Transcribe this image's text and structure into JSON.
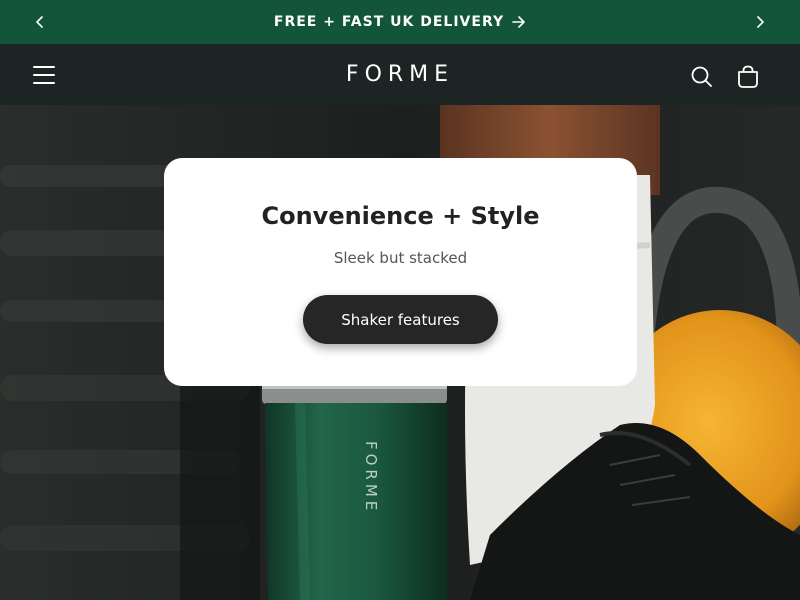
{
  "announcement": {
    "text": "FREE + FAST UK DELIVERY",
    "prev_icon": "chevron-left-icon",
    "next_icon": "chevron-right-icon"
  },
  "header": {
    "logo": "FORME",
    "menu_icon": "hamburger-icon",
    "search_icon": "search-icon",
    "cart_icon": "cart-icon"
  },
  "hero": {
    "bottle_brand": "FORME"
  },
  "card": {
    "title": "Convenience + Style",
    "subtitle": "Sleek but stacked",
    "button_label": "Shaker features"
  },
  "colors": {
    "announcement_bg": "#12553a",
    "header_bg": "#1d2424",
    "button_bg": "#262626",
    "bottle_green": "#1f5a3e",
    "kettlebell_orange": "#f0a21d"
  }
}
